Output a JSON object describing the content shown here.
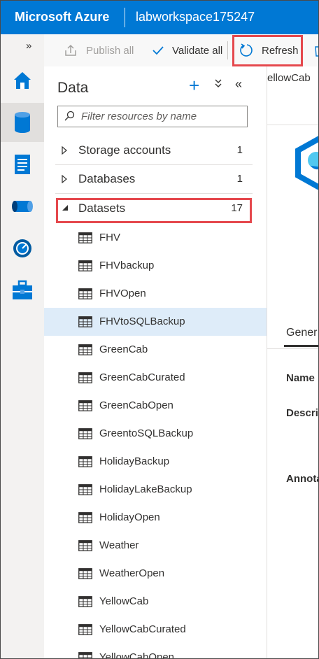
{
  "header": {
    "brand": "Microsoft Azure",
    "workspace": "labworkspace175247"
  },
  "rail": {
    "expand_glyph": "»",
    "items": [
      {
        "name": "home-icon"
      },
      {
        "name": "data-icon",
        "selected": true
      },
      {
        "name": "develop-icon"
      },
      {
        "name": "integrate-icon"
      },
      {
        "name": "monitor-icon"
      },
      {
        "name": "manage-icon"
      }
    ]
  },
  "toolbar": {
    "publish_label": "Publish all",
    "validate_label": "Validate all",
    "refresh_label": "Refresh"
  },
  "right_pane": {
    "tab_peek": "ellowCab",
    "general_tab": "Gener",
    "name_label": "Name",
    "description_label": "Descri",
    "annotations_label": "Annota"
  },
  "data_panel": {
    "title": "Data",
    "filter_placeholder": "Filter resources by name",
    "sections": [
      {
        "label": "Storage accounts",
        "count": "1",
        "expanded": false
      },
      {
        "label": "Databases",
        "count": "1",
        "expanded": false
      },
      {
        "label": "Datasets",
        "count": "17",
        "expanded": true
      }
    ],
    "datasets": [
      "FHV",
      "FHVbackup",
      "FHVOpen",
      "FHVtoSQLBackup",
      "GreenCab",
      "GreenCabCurated",
      "GreenCabOpen",
      "GreentoSQLBackup",
      "HolidayBackup",
      "HolidayLakeBackup",
      "HolidayOpen",
      "Weather",
      "WeatherOpen",
      "YellowCab",
      "YellowCabCurated",
      "YellowCabOpen"
    ],
    "selected_dataset": "FHVtoSQLBackup"
  },
  "colors": {
    "brand_blue": "#0078d4",
    "highlight_red": "#e5484d",
    "selected_row": "#deecf9"
  }
}
